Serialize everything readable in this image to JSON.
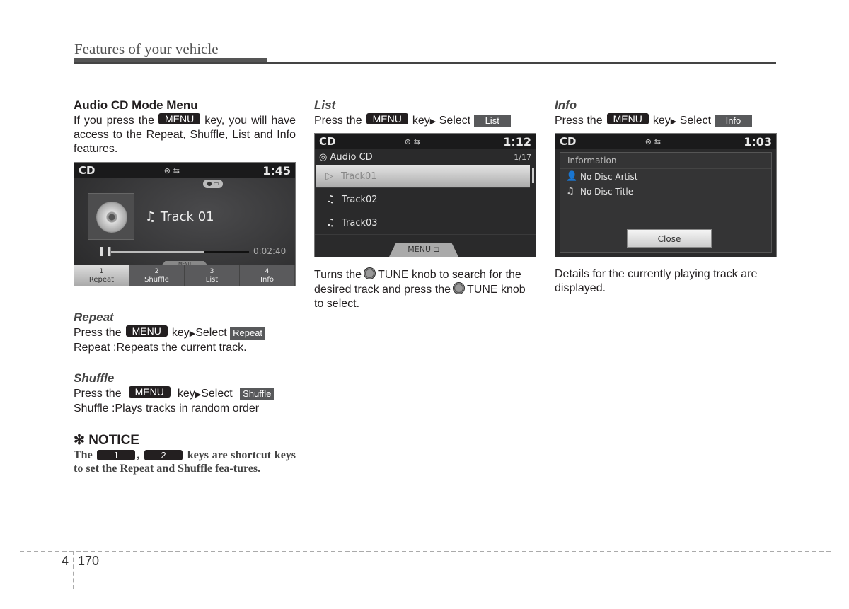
{
  "header": {
    "title": "Features of your vehicle"
  },
  "keys": {
    "menu": "MENU",
    "arrow": "▶"
  },
  "col1": {
    "heading": "Audio CD Mode Menu",
    "intro_a": "If you press the",
    "intro_b": "key, you will have access to the Repeat, Shuffle, List and Info features.",
    "screen": {
      "mode": "CD",
      "status_icons": "⊙ ⇆",
      "clock": "1:45",
      "bt_badge": "● ▭",
      "track_icon": "♫",
      "track_name": "Track 01",
      "pause_icon": "❚❚",
      "progress": 0.67,
      "elapsed": "0:02:40",
      "menu_tab": "MENU",
      "softkeys": [
        {
          "num": "1",
          "label": "Repeat"
        },
        {
          "num": "2",
          "label": "Shuffle"
        },
        {
          "num": "3",
          "label": "List"
        },
        {
          "num": "4",
          "label": "Info"
        }
      ]
    },
    "repeat": {
      "heading": "Repeat",
      "press": "Press the",
      "key_select": "key",
      "select": "Select",
      "button": "Repeat",
      "desc": "Repeat :Repeats the current track."
    },
    "shuffle": {
      "heading": "Shuffle",
      "press": "Press the",
      "key_select": "key",
      "select": "Select",
      "button": "Shuffle",
      "desc": "Shuffle :Plays tracks in random order"
    },
    "notice": {
      "heading": "✻ NOTICE",
      "text_a": "The",
      "key1": "1",
      "comma": ",",
      "key2": "2",
      "text_b": "keys are shortcut keys to set the Repeat and Shuffle fea-tures."
    }
  },
  "col2": {
    "heading": "List",
    "press": "Press the",
    "key_select": "key",
    "select": "Select",
    "button": "List",
    "screen": {
      "mode": "CD",
      "status_icons": "⊙ ⇆",
      "clock": "1:12",
      "source_icon": "◎",
      "source": "Audio CD",
      "page": "1/17",
      "tracks": [
        {
          "icon": "▷",
          "name": "Track01",
          "selected": true
        },
        {
          "icon": "♫",
          "name": "Track02",
          "selected": false
        },
        {
          "icon": "♫",
          "name": "Track03",
          "selected": false
        }
      ],
      "menu_back": "MENU ⊐"
    },
    "desc_a": "Turns the",
    "desc_b": "TUNE knob to  search for the desired track and press the",
    "desc_c": "TUNE knob to select."
  },
  "col3": {
    "heading": "Info",
    "press": "Press the",
    "key_select": "key",
    "select": "Select",
    "button": "Info",
    "screen": {
      "mode": "CD",
      "status_icons": "⊙ ⇆",
      "clock": "1:03",
      "panel_title": "Information",
      "artist_icon": "👤",
      "artist": "No Disc Artist",
      "title_icon": "♫",
      "title": "No Disc Title",
      "close": "Close"
    },
    "desc": "Details for the currently playing track are displayed."
  },
  "footer": {
    "chapter": "4",
    "page": "170"
  }
}
